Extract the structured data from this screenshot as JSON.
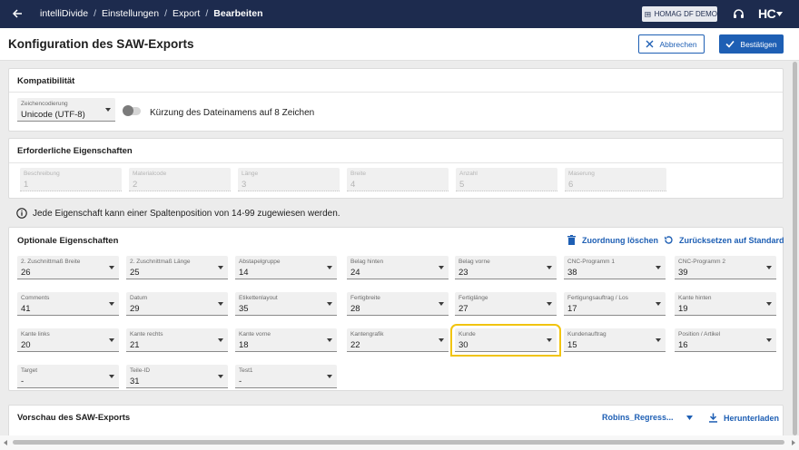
{
  "topbar": {
    "breadcrumbs": [
      "intelliDivide",
      "Einstellungen",
      "Export",
      "Bearbeiten"
    ],
    "tenant": "HOMAG DF DEMO",
    "logo": "HC"
  },
  "header": {
    "title": "Konfiguration des SAW-Exports",
    "cancel_label": "Abbrechen",
    "confirm_label": "Bestätigen"
  },
  "kompatibilitaet": {
    "title": "Kompatibilität",
    "encoding_label": "Zeichencodierung",
    "encoding_value": "Unicode (UTF-8)",
    "toggle_label": "Kürzung des Dateinamens auf 8 Zeichen",
    "toggle_on": false
  },
  "required": {
    "title": "Erforderliche Eigenschaften",
    "fields": [
      {
        "label": "Beschreibung",
        "value": "1"
      },
      {
        "label": "Materialcode",
        "value": "2"
      },
      {
        "label": "Länge",
        "value": "3"
      },
      {
        "label": "Breite",
        "value": "4"
      },
      {
        "label": "Anzahl",
        "value": "5"
      },
      {
        "label": "Maserung",
        "value": "6"
      }
    ]
  },
  "info_text": "Jede Eigenschaft kann einer Spaltenposition von 14-99 zugewiesen werden.",
  "optional": {
    "title": "Optionale Eigenschaften",
    "clear_label": "Zuordnung löschen",
    "reset_label": "Zurücksetzen auf Standard",
    "fields": [
      {
        "label": "2. Zuschnittmaß Breite",
        "value": "26"
      },
      {
        "label": "2. Zuschnittmaß Länge",
        "value": "25"
      },
      {
        "label": "Abstapelgruppe",
        "value": "14"
      },
      {
        "label": "Belag hinten",
        "value": "24"
      },
      {
        "label": "Belag vorne",
        "value": "23"
      },
      {
        "label": "CNC-Programm 1",
        "value": "38"
      },
      {
        "label": "CNC-Programm 2",
        "value": "39"
      },
      {
        "label": "Comments",
        "value": "41"
      },
      {
        "label": "Datum",
        "value": "29"
      },
      {
        "label": "Etikettenlayout",
        "value": "35"
      },
      {
        "label": "Fertigbreite",
        "value": "28"
      },
      {
        "label": "Fertiglänge",
        "value": "27"
      },
      {
        "label": "Fertigungsauftrag / Los",
        "value": "17"
      },
      {
        "label": "Kante hinten",
        "value": "19"
      },
      {
        "label": "Kante links",
        "value": "20"
      },
      {
        "label": "Kante rechts",
        "value": "21"
      },
      {
        "label": "Kante vorne",
        "value": "18"
      },
      {
        "label": "Kantengrafik",
        "value": "22"
      },
      {
        "label": "Kunde",
        "value": "30"
      },
      {
        "label": "Kundenauftrag",
        "value": "15"
      },
      {
        "label": "Position / Artikel",
        "value": "16"
      },
      {
        "label": "Target",
        "value": "-"
      },
      {
        "label": "Teile-ID",
        "value": "31"
      },
      {
        "label": "Test1",
        "value": "-"
      }
    ]
  },
  "preview": {
    "title": "Vorschau des SAW-Exports",
    "selected_job": "Robins_Regress...",
    "download_label": "Herunterladen"
  },
  "colors": {
    "topbar": "#1d2b4e",
    "accent": "#1e5fb4",
    "highlight": "#f1c40f"
  }
}
